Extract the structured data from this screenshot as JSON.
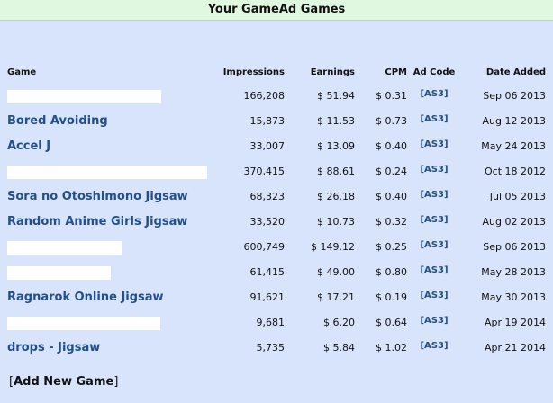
{
  "title": "Your GameAd Games",
  "columns": {
    "game": "Game",
    "impressions": "Impressions",
    "earnings": "Earnings",
    "cpm": "CPM",
    "ad_code": "Ad Code",
    "date_added": "Date Added"
  },
  "rows": [
    {
      "name": "",
      "impressions": "166,208",
      "earnings": "$ 51.94",
      "cpm": "$ 0.31",
      "ad": "[AS3]",
      "date": "Sep 06 2013"
    },
    {
      "name": "Bored Avoiding",
      "impressions": "15,873",
      "earnings": "$ 11.53",
      "cpm": "$ 0.73",
      "ad": "[AS3]",
      "date": "Aug 12 2013"
    },
    {
      "name": "Accel J",
      "impressions": "33,007",
      "earnings": "$ 13.09",
      "cpm": "$ 0.40",
      "ad": "[AS3]",
      "date": "May 24 2013"
    },
    {
      "name": "",
      "impressions": "370,415",
      "earnings": "$ 88.61",
      "cpm": "$ 0.24",
      "ad": "[AS3]",
      "date": "Oct 18 2012"
    },
    {
      "name": "Sora no Otoshimono Jigsaw",
      "impressions": "68,323",
      "earnings": "$ 26.18",
      "cpm": "$ 0.40",
      "ad": "[AS3]",
      "date": "Jul 05 2013"
    },
    {
      "name": "Random Anime Girls Jigsaw",
      "impressions": "33,520",
      "earnings": "$ 10.73",
      "cpm": "$ 0.32",
      "ad": "[AS3]",
      "date": "Aug 02 2013"
    },
    {
      "name": "",
      "impressions": "600,749",
      "earnings": "$ 149.12",
      "cpm": "$ 0.25",
      "ad": "[AS3]",
      "date": "Sep 06 2013"
    },
    {
      "name": "",
      "impressions": "61,415",
      "earnings": "$ 49.00",
      "cpm": "$ 0.80",
      "ad": "[AS3]",
      "date": "May 28 2013"
    },
    {
      "name": "Ragnarok Online Jigsaw",
      "impressions": "91,621",
      "earnings": "$ 17.21",
      "cpm": "$ 0.19",
      "ad": "[AS3]",
      "date": "May 30 2013"
    },
    {
      "name": "",
      "impressions": "9,681",
      "earnings": "$ 6.20",
      "cpm": "$ 0.64",
      "ad": "[AS3]",
      "date": "Apr 19 2014"
    },
    {
      "name": "drops - Jigsaw",
      "impressions": "5,735",
      "earnings": "$ 5.84",
      "cpm": "$ 1.02",
      "ad": "[AS3]",
      "date": "Apr 21 2014"
    }
  ],
  "add_new_game": {
    "open_bracket": "[",
    "label": "Add New Game",
    "close_bracket": "]"
  }
}
